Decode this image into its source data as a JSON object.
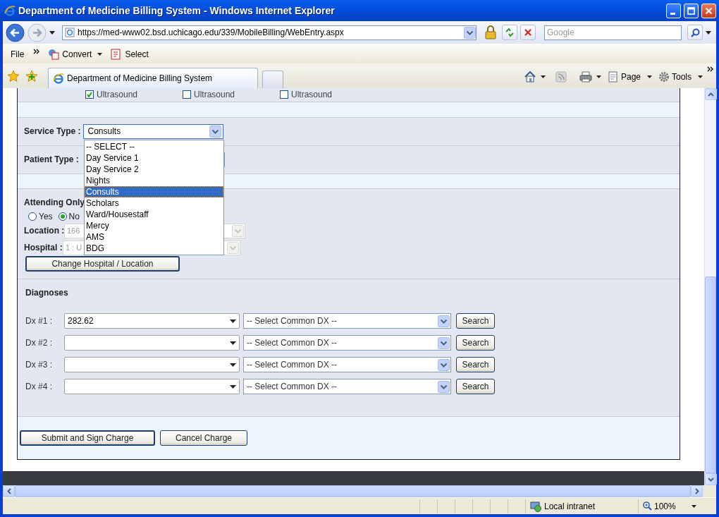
{
  "window": {
    "title": "Department of Medicine Billing System - Windows Internet Explorer"
  },
  "address_bar": {
    "url": "https://med-www02.bsd.uchicago.edu/339/MobileBilling/WebEntry.aspx"
  },
  "search": {
    "placeholder": "Google"
  },
  "menu": [
    {
      "label": "File"
    }
  ],
  "command_bar": [
    {
      "label": "Convert"
    },
    {
      "label": "Select"
    }
  ],
  "tabs": [
    {
      "label": "Department of Medicine Billing System",
      "selected": true
    }
  ],
  "tab_tools": [
    {
      "label": "Page"
    },
    {
      "label": "Tools"
    }
  ],
  "form": {
    "checkboxes": [
      {
        "label": "Ultrasound",
        "checked": true
      },
      {
        "label": "Ultrasound",
        "checked": false
      },
      {
        "label": "Ultrasound",
        "checked": false
      }
    ],
    "service_type": {
      "label": "Service Type :",
      "value": "Consults",
      "expanded": true,
      "options": [
        {
          "label": "-- SELECT --",
          "selected": false
        },
        {
          "label": "Day Service 1",
          "selected": false
        },
        {
          "label": "Day Service 2",
          "selected": false
        },
        {
          "label": "Nights",
          "selected": false
        },
        {
          "label": "Consults",
          "selected": true
        },
        {
          "label": "Scholars",
          "selected": false
        },
        {
          "label": "Ward/Housestaff",
          "selected": false
        },
        {
          "label": "Mercy",
          "selected": false
        },
        {
          "label": "AMS",
          "selected": false
        },
        {
          "label": "BDG",
          "selected": false
        }
      ]
    },
    "patient_type": {
      "label": "Patient Type :"
    },
    "attending_only": {
      "label": "Attending Only",
      "options": [
        {
          "label": "Yes",
          "selected": false
        },
        {
          "label": "No",
          "selected": true
        }
      ]
    },
    "location": {
      "label": "Location :",
      "value": "166",
      "disabled": true
    },
    "hospital": {
      "label": "Hospital :",
      "value": "1 : U",
      "disabled": true
    },
    "change_button": "Change Hospital / Location",
    "diagnoses": {
      "title": "Diagnoses",
      "rows": [
        {
          "label": "Dx #1 :",
          "code": "282.62",
          "common": "-- Select Common DX --",
          "button": "Search"
        },
        {
          "label": "Dx #2 :",
          "common": "-- Select Common DX --",
          "button": "Search"
        },
        {
          "label": "Dx #3 :",
          "common": "-- Select Common DX --",
          "button": "Search"
        },
        {
          "label": "Dx #4 :",
          "common": "-- Select Common DX --",
          "button": "Search"
        }
      ]
    },
    "actions": [
      {
        "label": "Submit and Sign Charge",
        "focused": true
      },
      {
        "label": "Cancel Charge",
        "focused": false
      }
    ]
  },
  "status_bar": {
    "zone": "Local intranet",
    "zoom": "100%"
  }
}
